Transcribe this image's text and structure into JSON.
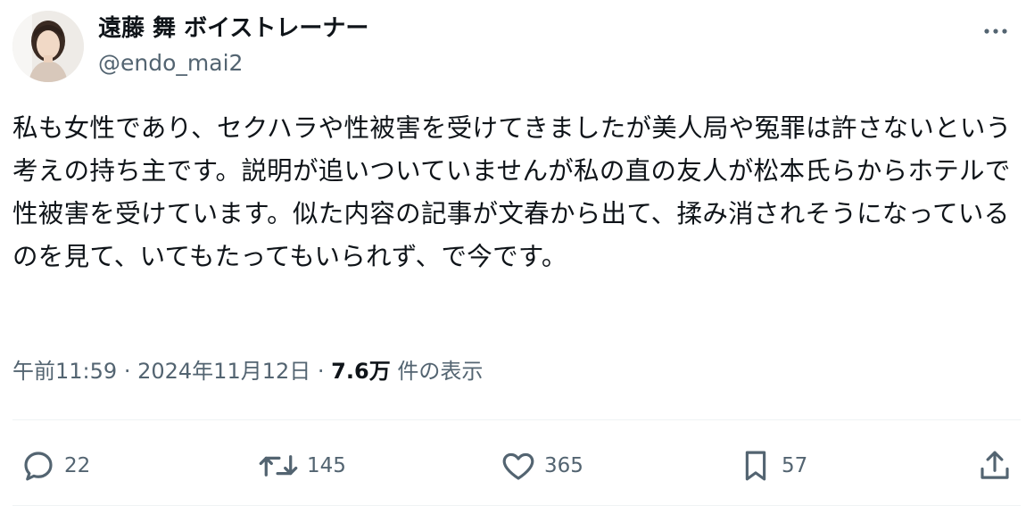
{
  "author": {
    "display_name": "遠藤 舞 ボイストレーナー",
    "handle": "@endo_mai2",
    "avatar_icon": "avatar-photo"
  },
  "tweet": {
    "text": "私も女性であり、セクハラや性被害を受けてきましたが美人局や冤罪は許さないという考えの持ち主です。説明が追いついていませんが私の直の友人が松本氏らからホテルで性被害を受けています。似た内容の記事が文春から出て、揉み消されそうになっているのを見て、いてもたってもいられず、で今です。",
    "time": "午前11:59",
    "separator": "·",
    "date": "2024年11月12日",
    "views_count": "7.6万",
    "views_label": "件の表示"
  },
  "actions": {
    "reply_count": "22",
    "retweet_count": "145",
    "like_count": "365",
    "bookmark_count": "57"
  },
  "colors": {
    "text_primary": "#0f1419",
    "text_secondary": "#536471",
    "divider": "#eff3f4"
  },
  "icons": [
    "more-icon",
    "reply-icon",
    "retweet-icon",
    "like-icon",
    "bookmark-icon",
    "share-icon"
  ]
}
